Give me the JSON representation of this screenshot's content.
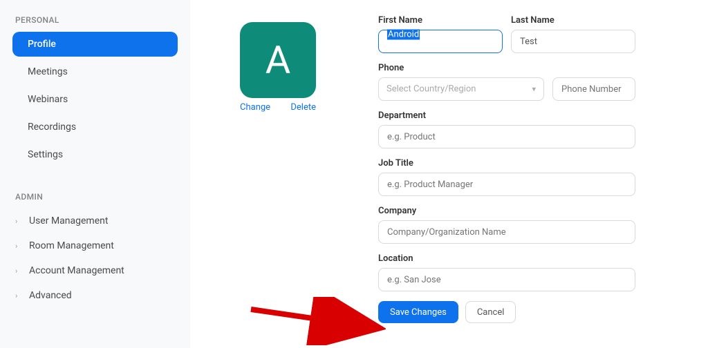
{
  "sidebar": {
    "personal_header": "PERSONAL",
    "items": [
      {
        "label": "Profile"
      },
      {
        "label": "Meetings"
      },
      {
        "label": "Webinars"
      },
      {
        "label": "Recordings"
      },
      {
        "label": "Settings"
      }
    ],
    "admin_header": "ADMIN",
    "admin_items": [
      {
        "label": "User Management"
      },
      {
        "label": "Room Management"
      },
      {
        "label": "Account Management"
      },
      {
        "label": "Advanced"
      }
    ]
  },
  "avatar": {
    "initial": "A",
    "change": "Change",
    "delete": "Delete"
  },
  "form": {
    "first_name": {
      "label": "First Name",
      "value": "Android"
    },
    "last_name": {
      "label": "Last Name",
      "value": "Test"
    },
    "phone": {
      "label": "Phone",
      "placeholder_region": "Select Country/Region",
      "placeholder_number": "Phone Number"
    },
    "department": {
      "label": "Department",
      "placeholder": "e.g. Product"
    },
    "job_title": {
      "label": "Job Title",
      "placeholder": "e.g. Product Manager"
    },
    "company": {
      "label": "Company",
      "placeholder": "Company/Organization Name"
    },
    "location": {
      "label": "Location",
      "placeholder": "e.g. San Jose"
    },
    "save": "Save Changes",
    "cancel": "Cancel"
  }
}
